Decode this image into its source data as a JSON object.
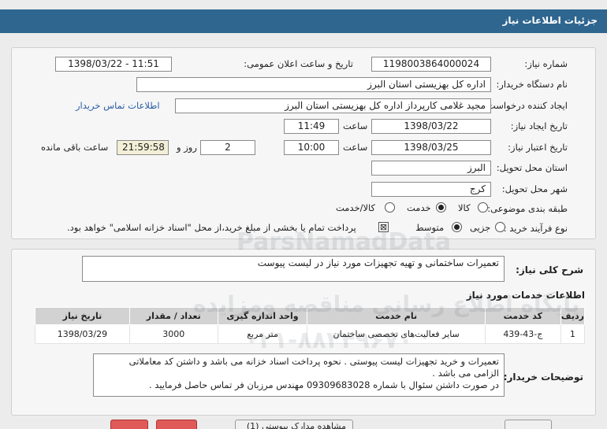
{
  "header": {
    "title": "جزئیات اطلاعات نیاز"
  },
  "form": {
    "need_number_label": "شماره نیاز:",
    "need_number": "1198003864000024",
    "announce_label": "تاریخ و ساعت اعلان عمومی:",
    "announce_value": "1398/03/22 - 11:51",
    "buyer_label": "نام دستگاه خریدار:",
    "buyer_value": "اداره کل بهزیستی استان البرز",
    "creator_label": "ایجاد کننده درخواست:",
    "creator_value": "مجید غلامی کارپرداز اداره کل بهزیستی استان البرز",
    "contact_link": "اطلاعات تماس خریدار",
    "created_label": "تاریخ ایجاد نیاز:",
    "created_date": "1398/03/22",
    "time_word": "ساعت",
    "created_time": "11:49",
    "validity_label": "تاریخ اعتبار نیاز:",
    "validity_date": "1398/03/25",
    "validity_time": "10:00",
    "days_value": "2",
    "days_word": "روز و",
    "remaining_time": "21:59:58",
    "remaining_label": "ساعت باقی مانده",
    "province_label": "استان محل تحویل:",
    "province_value": "البرز",
    "city_label": "شهر محل تحویل:",
    "city_value": "کرج",
    "category_label": "طبقه بندی موضوعی:",
    "category_options": [
      "کالا",
      "خدمت",
      "کالا/خدمت"
    ],
    "category_selected": "خدمت",
    "process_label": "نوع فرآیند خرید :",
    "process_options": [
      "جزیی",
      "متوسط"
    ],
    "process_selected": "متوسط",
    "payment_note": "پرداخت تمام یا بخشی از مبلغ خرید،از محل \"اسناد خزانه اسلامی\" خواهد بود."
  },
  "summary": {
    "label": "شرح کلی نیاز:",
    "value": "تعمیرات ساختمانی و تهیه تجهیزات مورد نیاز  در لیست پیوست",
    "services_title": "اطلاعات خدمات مورد نیاز"
  },
  "table": {
    "headers": [
      "ردیف",
      "کد خدمت",
      "نام خدمت",
      "واحد اندازه گیری",
      "تعداد / مقدار",
      "تاریخ نیاز"
    ],
    "rows": [
      [
        "1",
        "ج-43-439",
        "سایر فعالیت‌های تخصصی ساختمان",
        "متر مربع",
        "3000",
        "1398/03/29"
      ]
    ]
  },
  "buyer_notes": {
    "label": "توضیحات خریدار:",
    "line1": "تعمیرات و خرید تجهیزات لیست پیوستی . نحوه پرداخت اسناد خزانه می باشد و داشتن کد معاملاتی",
    "line2": "الزامی می باشد .",
    "line3": "در صورت داشتن سئوال با شماره 09309683028 مهندس مرزبان فر تماس حاصل فرمایید ."
  },
  "watermark": {
    "line1": "پایگاه اطلاع رسانی مناقصه ومزایده",
    "line2": "ParsNamadData",
    "line3": "۰۲۱-۸۸۳۴۹۶۷۰"
  },
  "footer": {
    "partial_text": "مشاهده مدارک پیوستی (1)"
  },
  "colors": {
    "titlebar": "#2f6690",
    "link": "#2a5ea6"
  }
}
